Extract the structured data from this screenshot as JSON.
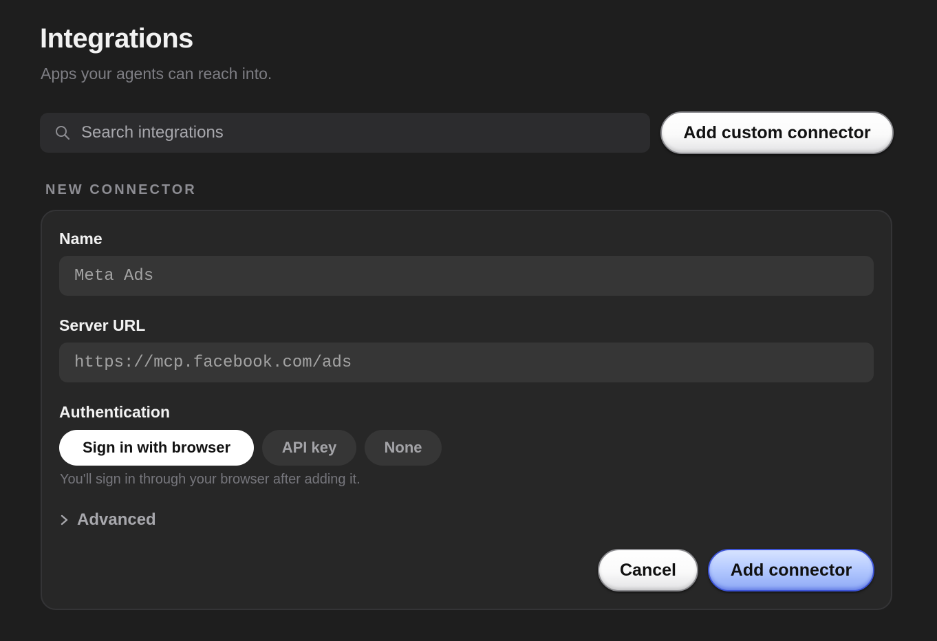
{
  "header": {
    "title": "Integrations",
    "subtitle": "Apps your agents can reach into."
  },
  "search": {
    "placeholder": "Search integrations",
    "value": "",
    "icon": "search-icon"
  },
  "toolbar": {
    "add_custom_label": "Add custom connector"
  },
  "new_connector": {
    "section_label": "NEW CONNECTOR",
    "name": {
      "label": "Name",
      "placeholder": "Meta Ads",
      "value": ""
    },
    "server_url": {
      "label": "Server URL",
      "placeholder": "https://mcp.facebook.com/ads",
      "value": ""
    },
    "authentication": {
      "label": "Authentication",
      "options": [
        {
          "label": "Sign in with browser",
          "selected": true
        },
        {
          "label": "API key",
          "selected": false
        },
        {
          "label": "None",
          "selected": false
        }
      ],
      "help": "You'll sign in through your browser after adding it."
    },
    "advanced": {
      "label": "Advanced",
      "icon": "chevron-right-icon"
    },
    "actions": {
      "cancel_label": "Cancel",
      "submit_label": "Add connector"
    }
  },
  "colors": {
    "background": "#1e1e1e",
    "card": "#272727",
    "input": "#363636",
    "accent_blue": "#3d54d6"
  }
}
